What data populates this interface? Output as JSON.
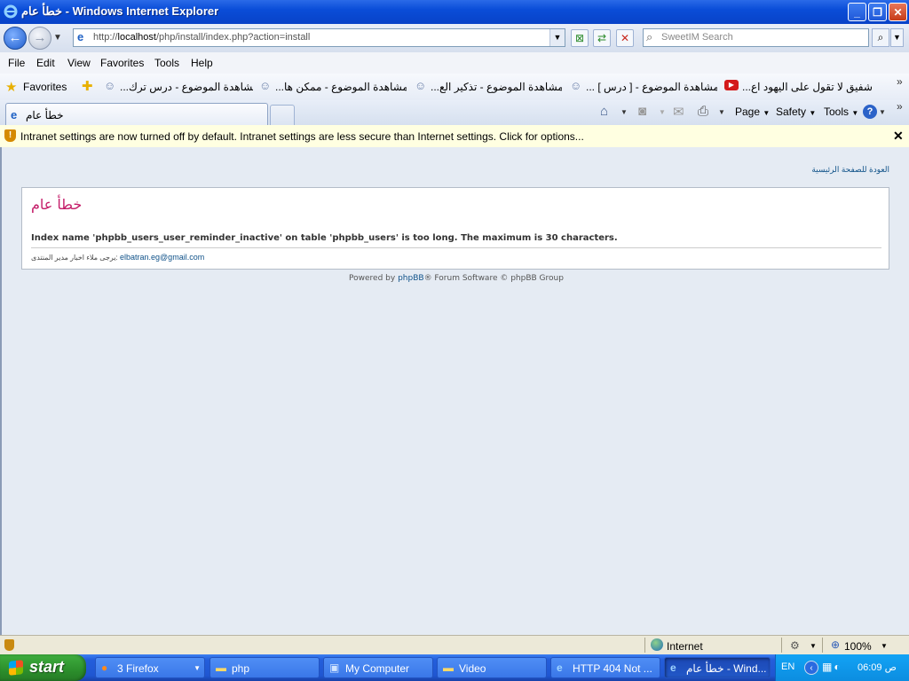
{
  "window": {
    "title": "خطأ عام - Windows Internet Explorer",
    "min_glyph": "_",
    "max_glyph": "❐",
    "close_glyph": "✕"
  },
  "address_bar": {
    "url_prefix": "http://",
    "url_host": "localhost",
    "url_path": "/php/install/index.php?action=install",
    "search_placeholder": "SweetIM Search"
  },
  "menu": [
    "File",
    "Edit",
    "View",
    "Favorites",
    "Tools",
    "Help"
  ],
  "favorites_bar": {
    "label": "Favorites",
    "links": [
      "...مشاهدة الموضوع - درس ترك",
      "...مشاهدة الموضوع - ممكن ها",
      "...مشاهدة الموضوع - تذكير الع",
      "...  [ مشاهدة الموضوع - [ درس",
      "...شفيق  لا تقول على اليهود اع"
    ],
    "more_glyph": "»"
  },
  "tab": {
    "label": "خطأ عام"
  },
  "command_bar": {
    "page": "Page",
    "safety": "Safety",
    "tools": "Tools",
    "more_glyph": "»"
  },
  "info_bar": {
    "message": "Intranet settings are now turned off by default. Intranet settings are less secure than Internet settings. Click for options...",
    "close_glyph": "✕"
  },
  "page": {
    "home_link": "العودة للصفحة الرئيسية",
    "error_title": "خطأ عام",
    "error_message": "Index name 'phpbb_users_user_reminder_inactive' on table 'phpbb_users' is too long. The maximum is 30 characters.",
    "contact_text": "يرجى ملاء اخبار مدير المنتدى:",
    "contact_email": "elbatran.eg@gmail.com",
    "powered_prefix": "Powered by",
    "powered_link": "phpBB",
    "powered_suffix": "® Forum Software © phpBB Group"
  },
  "status_bar": {
    "zone": "Internet",
    "zoom": "100%"
  },
  "taskbar": {
    "start": "start",
    "tasks": [
      {
        "label": "3 Firefox",
        "icon": "firefox-icon"
      },
      {
        "label": "php",
        "icon": "folder-icon"
      },
      {
        "label": "My Computer",
        "icon": "computer-icon"
      },
      {
        "label": "Video",
        "icon": "folder-icon"
      },
      {
        "label": "HTTP 404 Not ...",
        "icon": "ie-icon"
      },
      {
        "label": "خطأ عام - Wind...",
        "icon": "ie-icon"
      }
    ],
    "lang": "EN",
    "clock": "06:09 ص"
  },
  "colors": {
    "error_title": "#c41d69",
    "link": "#105289",
    "titlebar": "#0a4dd8"
  }
}
